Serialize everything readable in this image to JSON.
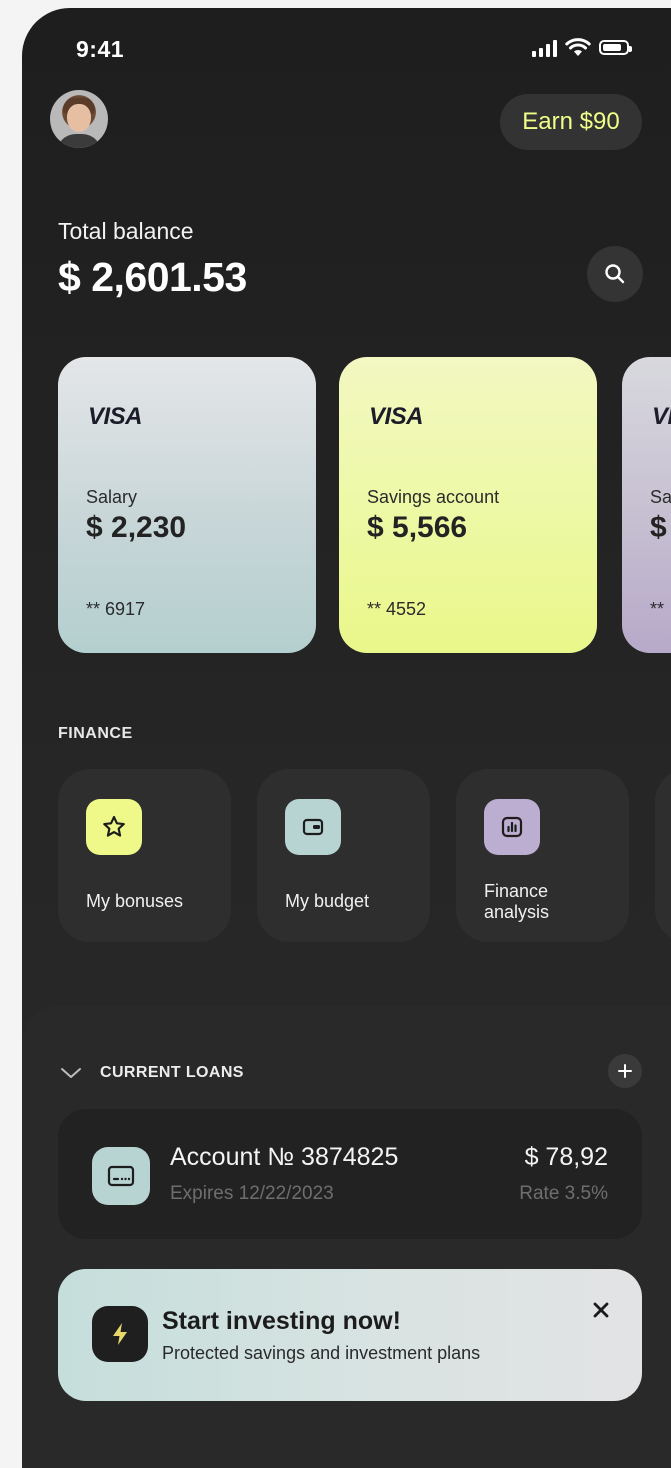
{
  "status": {
    "time": "9:41"
  },
  "header": {
    "earn_label": "Earn $90"
  },
  "balance": {
    "label": "Total balance",
    "value": "$ 2,601.53"
  },
  "cards": [
    {
      "brand": "VISA",
      "name": "Salary",
      "amount": "$ 2,230",
      "number": "** 6917"
    },
    {
      "brand": "VISA",
      "name": "Savings account",
      "amount": "$ 5,566",
      "number": "** 4552"
    },
    {
      "brand": "VISA",
      "name": "Sa",
      "amount": "$",
      "number": "**"
    }
  ],
  "finance": {
    "title": "FINANCE",
    "tiles": [
      {
        "label": "My bonuses",
        "icon": "star-icon",
        "color": "#eef98a"
      },
      {
        "label": "My budget",
        "icon": "wallet-icon",
        "color": "#b7d3d2"
      },
      {
        "label": "Finance analysis",
        "icon": "chart-icon",
        "color": "#bcaed0"
      }
    ]
  },
  "loans": {
    "title": "CURRENT LOANS",
    "account": {
      "title": "Account № 3874825",
      "expires": "Expires 12/22/2023",
      "amount": "$ 78,92",
      "rate": "Rate 3.5%"
    }
  },
  "promo": {
    "title": "Start investing now!",
    "subtitle": "Protected savings and investment plans"
  },
  "colors": {
    "accent_lime": "#eef98a",
    "accent_teal": "#b7d3d2",
    "accent_lilac": "#bcaed0",
    "background": "#1e1e1e"
  }
}
